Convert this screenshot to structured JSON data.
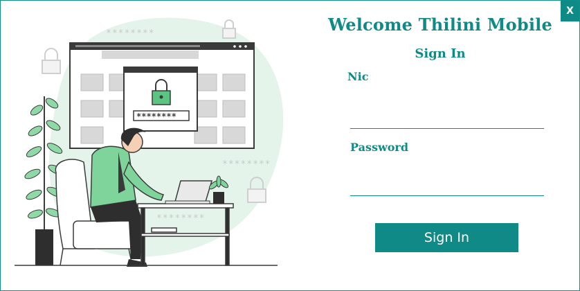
{
  "window": {
    "close_label": "X"
  },
  "header": {
    "title": "Welcome Thilini Mobile",
    "subtitle": "Sign In"
  },
  "form": {
    "nic_label": "Nic",
    "nic_value": "",
    "password_label": "Password",
    "password_value": "",
    "submit_label": "Sign In"
  },
  "illustration": {
    "masked_text": "********",
    "icons": [
      "lock-icon",
      "folder-icon",
      "laptop-icon",
      "plant-icon",
      "person-icon",
      "armchair-icon"
    ]
  },
  "colors": {
    "accent": "#0f8a86",
    "illustration_green": "#5cc481",
    "blob": "#e4f4ea"
  }
}
